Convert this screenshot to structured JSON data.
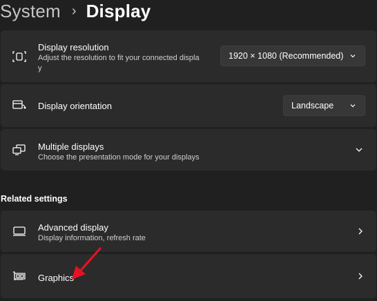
{
  "breadcrumb": {
    "parent": "System",
    "separator": "›",
    "current": "Display"
  },
  "cards": {
    "resolution": {
      "title": "Display resolution",
      "subtitle_line1": "Adjust the resolution to fit your connected displa",
      "subtitle_line2": "y",
      "dropdown_value": "1920 × 1080 (Recommended)",
      "icon": "display-resolution-icon"
    },
    "orientation": {
      "title": "Display orientation",
      "dropdown_value": "Landscape",
      "icon": "orientation-icon"
    },
    "multiple": {
      "title": "Multiple displays",
      "subtitle": "Choose the presentation mode for your displays",
      "icon": "multiple-displays-icon"
    }
  },
  "related": {
    "label": "Related settings",
    "advanced": {
      "title": "Advanced display",
      "subtitle": "Display information, refresh rate",
      "icon": "monitor-icon"
    },
    "graphics": {
      "title": "Graphics",
      "icon": "graphics-card-icon"
    }
  },
  "colors": {
    "background": "#202020",
    "card": "#2b2b2b",
    "dropdown": "#373737",
    "annotation_arrow": "#e81123"
  }
}
